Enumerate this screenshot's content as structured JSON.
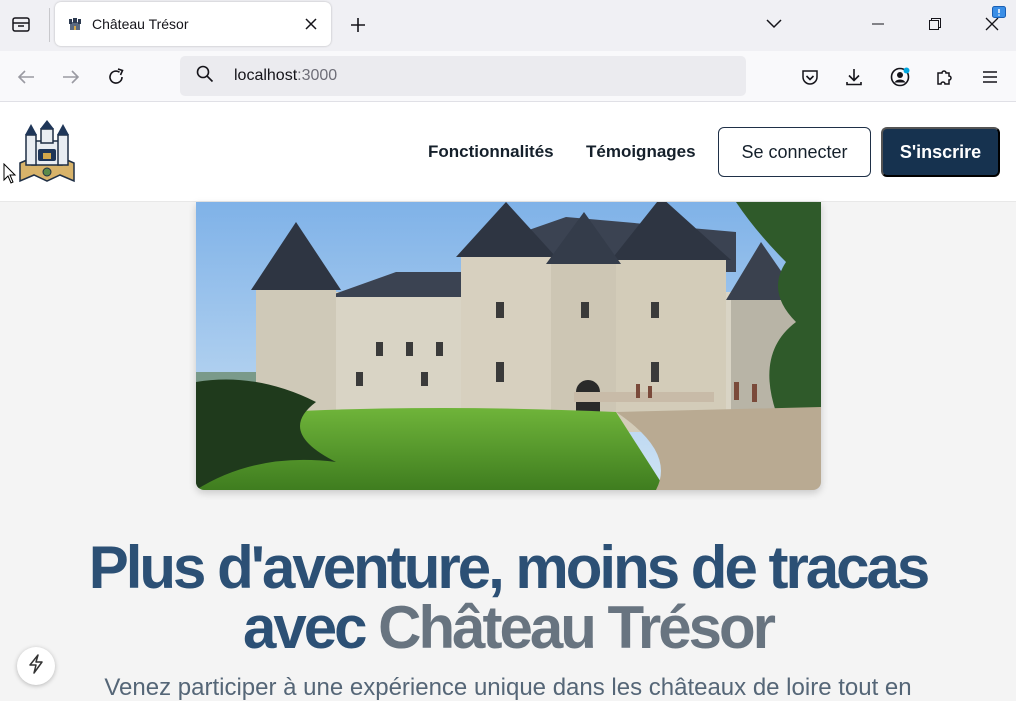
{
  "browser": {
    "tab_title": "Château Trésor",
    "url_host": "localhost",
    "url_port": ":3000"
  },
  "icons": {
    "tab_list": "tab-list-icon",
    "favicon": "castle-icon",
    "close_tab": "close-icon",
    "new_tab": "plus-icon",
    "list_all_tabs": "chevron-down-icon",
    "minimize": "minimize-icon",
    "restore": "restore-icon",
    "close_window": "close-icon",
    "back": "back-arrow-icon",
    "forward": "forward-arrow-icon",
    "reload": "reload-icon",
    "search": "search-icon",
    "pocket": "pocket-icon",
    "downloads": "download-icon",
    "account": "account-icon",
    "extensions": "puzzle-icon",
    "menu": "hamburger-menu-icon",
    "dev_toolbar": "lightning-icon"
  },
  "header": {
    "nav": [
      "Fonctionnalités",
      "Témoignages"
    ],
    "login_label": "Se connecter",
    "signup_label": "S'inscrire"
  },
  "hero": {
    "title_line1": "Plus d'aventure, moins de tracas",
    "title_avec": "avec",
    "title_brand": "Château Trésor",
    "subtitle": "Venez participer à une expérience unique dans les châteaux de loire tout en"
  },
  "colors": {
    "primary": "#16324f",
    "title": "#2c5075",
    "accent_gray": "#687480"
  }
}
